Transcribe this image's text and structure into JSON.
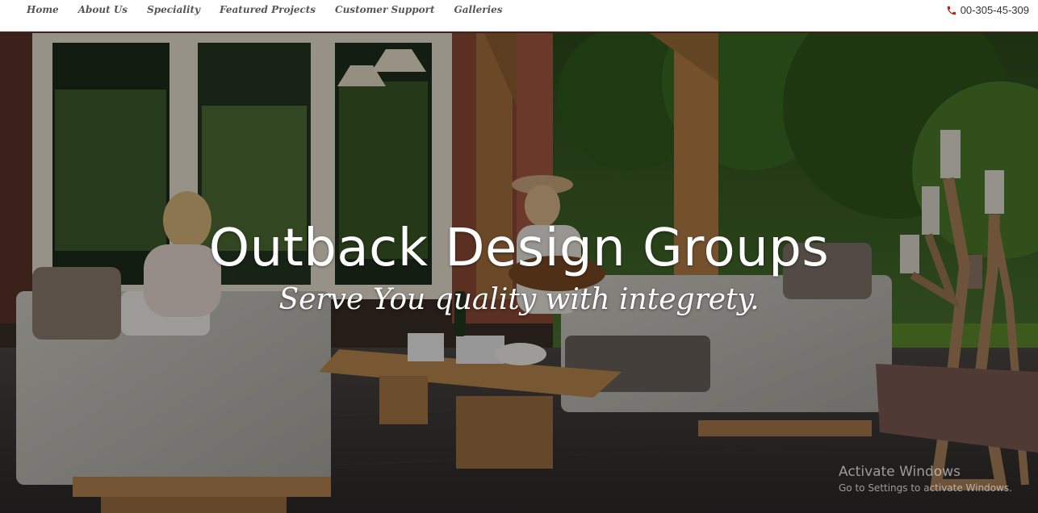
{
  "nav": {
    "items": [
      {
        "label": "Home"
      },
      {
        "label": "About Us"
      },
      {
        "label": "Speciality"
      },
      {
        "label": "Featured Projects"
      },
      {
        "label": "Customer Support"
      },
      {
        "label": "Galleries"
      }
    ],
    "phone": {
      "number": "00-305-45-309",
      "icon": "phone-icon"
    }
  },
  "hero": {
    "title": "Outback Design Groups",
    "subtitle": "Serve You quality with integrety."
  },
  "watermark": {
    "title": "Activate Windows",
    "subtitle": "Go to Settings to activate Windows."
  },
  "colors": {
    "nav_text": "#555555",
    "nav_border": "#7a1d14",
    "phone_icon": "#b3261e",
    "hero_text": "#ffffff"
  }
}
